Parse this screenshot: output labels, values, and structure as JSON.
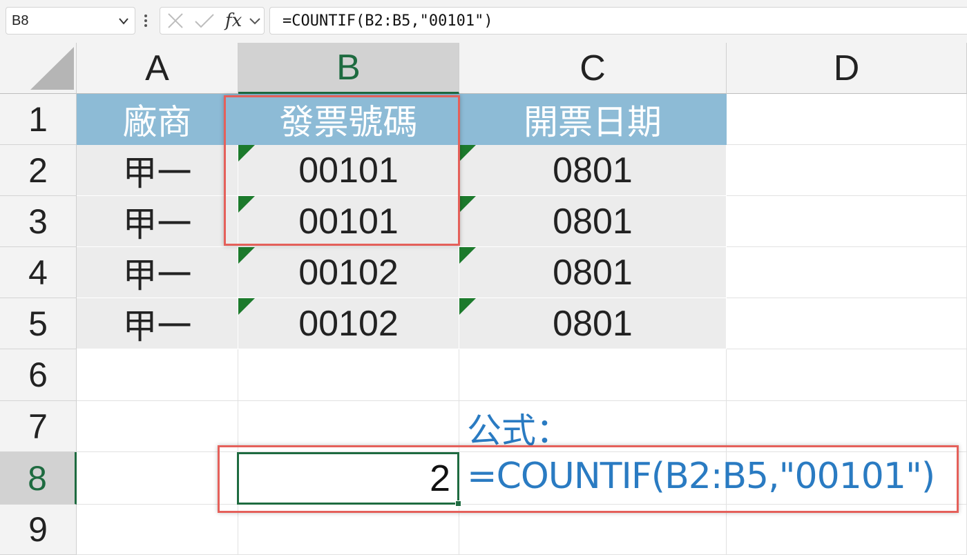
{
  "formula_bar": {
    "name_box": "B8",
    "fx_label": "fx",
    "formula": "=COUNTIF(B2:B5,\"00101\")"
  },
  "columns": [
    "A",
    "B",
    "C",
    "D"
  ],
  "rows": [
    "1",
    "2",
    "3",
    "4",
    "5",
    "6",
    "7",
    "8",
    "9"
  ],
  "selected": {
    "column": "B",
    "row": "8"
  },
  "table": {
    "headers": [
      "廠商",
      "發票號碼",
      "開票日期"
    ],
    "rows": [
      [
        "甲一",
        "00101",
        "0801"
      ],
      [
        "甲一",
        "00101",
        "0801"
      ],
      [
        "甲一",
        "00102",
        "0801"
      ],
      [
        "甲一",
        "00102",
        "0801"
      ]
    ]
  },
  "result_cell": {
    "ref": "B8",
    "value": "2"
  },
  "annotation": {
    "label": "公式：",
    "formula": "=COUNTIF(B2:B5,\"00101\")"
  },
  "colors": {
    "header_fill": "#8dbbd6",
    "data_fill": "#ececec",
    "highlight_border": "#e5605a",
    "selection": "#1e6b40",
    "annotation_text": "#2a7bc2",
    "text_indicator": "#1c7a2c"
  }
}
